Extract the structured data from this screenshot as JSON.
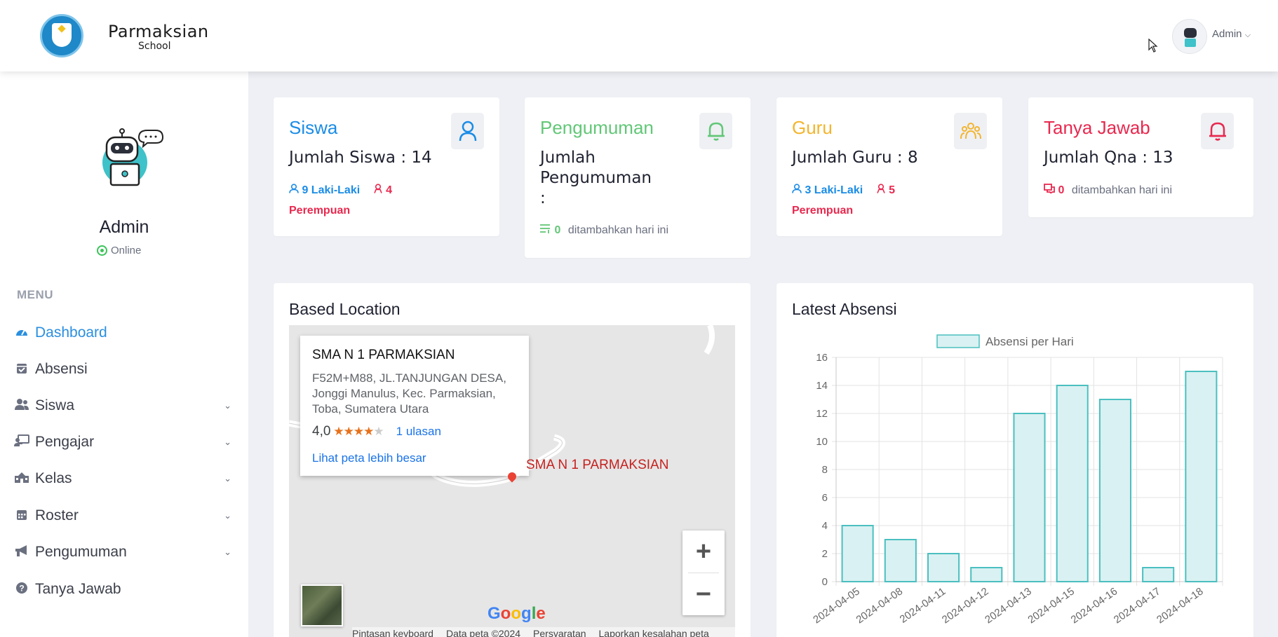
{
  "brand": {
    "title": "Parmaksian",
    "subtitle": "School"
  },
  "topbar": {
    "user_label": "Admin",
    "user_chevron": "⌄"
  },
  "sidebar": {
    "profile_name": "Admin",
    "status": "Online",
    "menu_title": "MENU",
    "items": [
      {
        "label": "Dashboard",
        "icon": "gauge-icon",
        "has_chevron": false,
        "active": true
      },
      {
        "label": "Absensi",
        "icon": "calendar-check-icon",
        "has_chevron": false
      },
      {
        "label": "Siswa",
        "icon": "user-group-icon",
        "has_chevron": true
      },
      {
        "label": "Pengajar",
        "icon": "chalkboard-teacher-icon",
        "has_chevron": true
      },
      {
        "label": "Kelas",
        "icon": "school-icon",
        "has_chevron": true
      },
      {
        "label": "Roster",
        "icon": "calendar-icon",
        "has_chevron": true
      },
      {
        "label": "Pengumuman",
        "icon": "bullhorn-icon",
        "has_chevron": true
      },
      {
        "label": "Tanya Jawab",
        "icon": "question-circle-icon",
        "has_chevron": false
      }
    ]
  },
  "cards": {
    "siswa": {
      "title": "Siswa",
      "count": "Jumlah Siswa : 14",
      "male": "9 Laki-Laki",
      "female_num": "4",
      "female_label": "Perempuan",
      "color": "#1a8ce6"
    },
    "pengumuman": {
      "title": "Pengumuman",
      "count_line1": "Jumlah",
      "count_line2": "Pengumuman",
      "count_line3": ":",
      "added_num": "0",
      "added_label": "ditambahkan hari ini",
      "color": "#62c777"
    },
    "guru": {
      "title": "Guru",
      "count": "Jumlah Guru : 8",
      "male": "3 Laki-Laki",
      "female_num": "5",
      "female_label": "Perempuan",
      "color": "#f3b52e"
    },
    "tanya": {
      "title": "Tanya Jawab",
      "count": "Jumlah Qna : 13",
      "added_num": "0",
      "added_label": "ditambahkan hari ini",
      "color": "#e8294f"
    }
  },
  "location": {
    "title": "Based Location",
    "place_name": "SMA N 1 PARMAKSIAN",
    "address_line1": "F52M+M88, JL.TANJUNGAN DESA,",
    "address_line2": "Jonggi Manulus, Kec. Parmaksian,",
    "address_line3": "Toba, Sumatera Utara",
    "rating": "4,0",
    "stars": 4,
    "reviews": "1 ulasan",
    "larger_map_link": "Lihat peta lebih besar",
    "marker_label": "SMA N 1 PARMAKSIAN",
    "zoom_in": "+",
    "zoom_out": "−",
    "google": "Google",
    "footer": [
      "Pintasan keyboard",
      "Data peta ©2024",
      "Persyaratan",
      "Laporkan kesalahan peta"
    ]
  },
  "absensi": {
    "title": "Latest Absensi"
  },
  "chart_data": {
    "type": "bar",
    "categories": [
      "2024-04-05",
      "2024-04-08",
      "2024-04-11",
      "2024-04-12",
      "2024-04-13",
      "2024-04-15",
      "2024-04-16",
      "2024-04-17",
      "2024-04-18"
    ],
    "series": [
      {
        "name": "Absensi per Hari",
        "values": [
          4,
          3,
          2,
          1,
          12,
          14,
          13,
          1,
          15
        ]
      }
    ],
    "ylim": [
      0,
      16
    ],
    "yticks": [
      0,
      2,
      4,
      6,
      8,
      10,
      12,
      14,
      16
    ],
    "grid": true,
    "legend": "top",
    "bar_fill": "#d9f1f2",
    "bar_stroke": "#4bbfc0"
  }
}
